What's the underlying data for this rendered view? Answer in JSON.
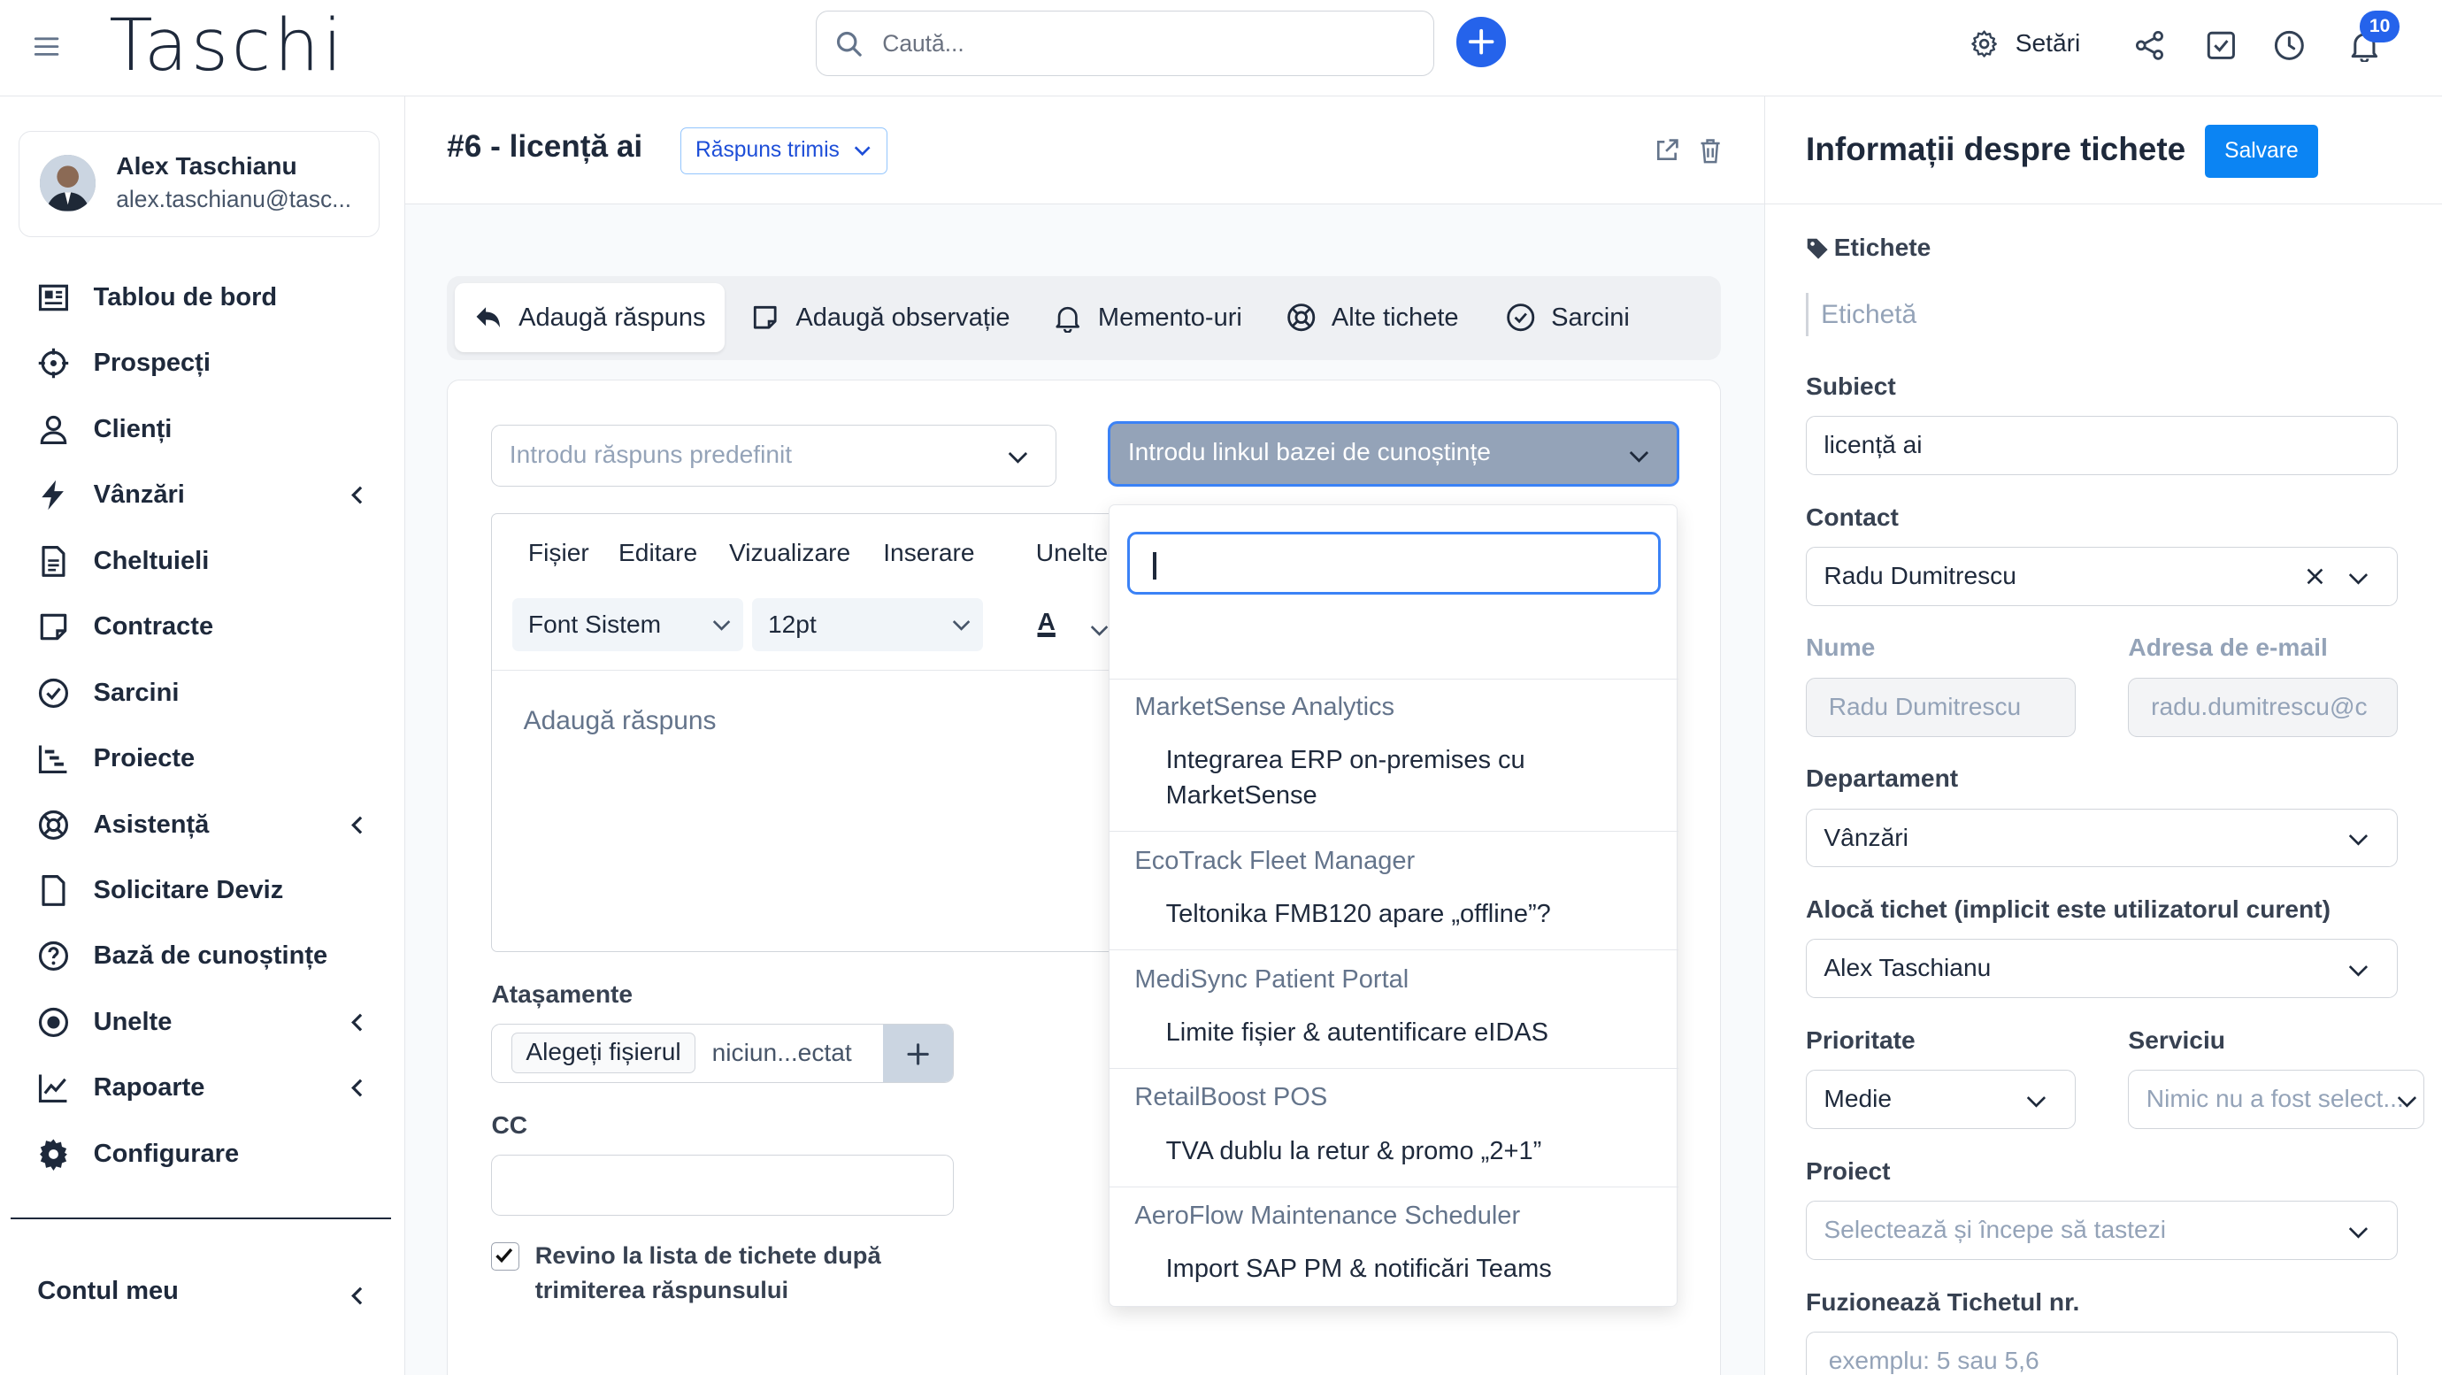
{
  "topbar": {
    "logo": "Taschi",
    "search_placeholder": "Caută...",
    "settings_label": "Setări",
    "notifications_count": "10"
  },
  "user": {
    "name": "Alex Taschianu",
    "email": "alex.taschianu@tasc..."
  },
  "sidebar": {
    "items": [
      {
        "label": "Tablou de bord",
        "icon": "dashboard-icon"
      },
      {
        "label": "Prospecți",
        "icon": "crosshair-icon"
      },
      {
        "label": "Clienți",
        "icon": "user-icon"
      },
      {
        "label": "Vânzări",
        "icon": "bolt-icon",
        "chevron": true
      },
      {
        "label": "Cheltuieli",
        "icon": "file-text-icon"
      },
      {
        "label": "Contracte",
        "icon": "contract-icon"
      },
      {
        "label": "Sarcini",
        "icon": "check-circle-icon"
      },
      {
        "label": "Proiecte",
        "icon": "gantt-icon"
      },
      {
        "label": "Asistență",
        "icon": "lifebuoy-icon",
        "chevron": true
      },
      {
        "label": "Solicitare Deviz",
        "icon": "file-icon"
      },
      {
        "label": "Bază de cunoștințe",
        "icon": "question-icon"
      },
      {
        "label": "Unelte",
        "icon": "dot-circle-icon",
        "chevron": true
      },
      {
        "label": "Rapoarte",
        "icon": "line-chart-icon",
        "chevron": true
      },
      {
        "label": "Configurare",
        "icon": "cog-icon"
      }
    ],
    "account_label": "Contul meu"
  },
  "ticket": {
    "title": "#6 - licență ai",
    "status": "Răspuns trimis"
  },
  "tabs": [
    {
      "label": "Adaugă răspuns",
      "icon": "reply-icon"
    },
    {
      "label": "Adaugă observație",
      "icon": "note-icon"
    },
    {
      "label": "Memento-uri",
      "icon": "bell-icon"
    },
    {
      "label": "Alte tichete",
      "icon": "lifebuoy-icon"
    },
    {
      "label": "Sarcini",
      "icon": "check-circle-icon"
    }
  ],
  "reply": {
    "predefined_placeholder": "Introdu răspuns predefinit",
    "kb_placeholder": "Introdu linkul bazei de cunoștințe",
    "editor_menu": [
      "Fișier",
      "Editare",
      "Vizualizare",
      "Inserare",
      "Unelte"
    ],
    "font_family": "Font Sistem",
    "font_size": "12pt",
    "text_color_label": "A",
    "editor_placeholder": "Adaugă răspuns",
    "attachments_label": "Atașamente",
    "choose_file": "Alegeți fișierul",
    "no_file": "niciun...ectat",
    "cc_label": "CC",
    "return_checkbox": "Revino la lista de tichete după trimiterea răspunsului",
    "return_checked": true
  },
  "kb_dropdown": {
    "search_value": "",
    "groups": [
      {
        "name": "MarketSense Analytics",
        "option": "Integrarea ERP on-premises cu MarketSense"
      },
      {
        "name": "EcoTrack Fleet Manager",
        "option": "Teltonika FMB120 apare „offline”?"
      },
      {
        "name": "MediSync Patient Portal",
        "option": "Limite fișier & autentificare eIDAS"
      },
      {
        "name": "RetailBoost POS",
        "option": "TVA dublu la retur & promo „2+1”"
      },
      {
        "name": "AeroFlow Maintenance Scheduler",
        "option": "Import SAP PM & notificări Teams"
      }
    ]
  },
  "info": {
    "title": "Informații despre tichete",
    "save_label": "Salvare",
    "tags_label": "Etichete",
    "tags_placeholder": "Etichetă",
    "subject_label": "Subiect",
    "subject_value": "licență ai",
    "contact_label": "Contact",
    "contact_value": "Radu Dumitrescu",
    "name_label": "Nume",
    "name_value": "Radu Dumitrescu",
    "email_label": "Adresa de e-mail",
    "email_value": "radu.dumitrescu@c",
    "department_label": "Departament",
    "department_value": "Vânzări",
    "assign_label": "Alocă tichet (implicit este utilizatorul curent)",
    "assign_value": "Alex Taschianu",
    "priority_label": "Prioritate",
    "priority_value": "Medie",
    "service_label": "Serviciu",
    "service_placeholder": "Nimic nu a fost select...",
    "project_label": "Proiect",
    "project_placeholder": "Selectează și începe să tastezi",
    "merge_label": "Fuzionează Tichetul nr.",
    "merge_placeholder": "exemplu: 5 sau 5,6"
  },
  "colors": {
    "primary": "#2563eb",
    "save_button": "#0b84f3"
  }
}
